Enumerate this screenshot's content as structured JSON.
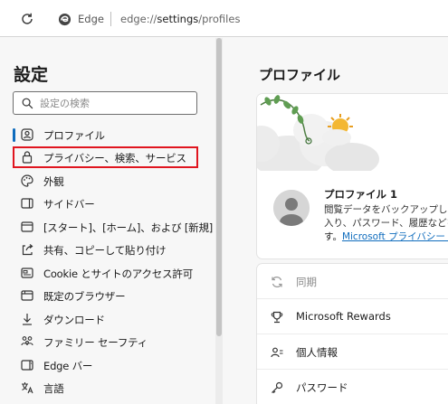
{
  "browser": {
    "name": "Edge",
    "url_prefix": "edge://",
    "url_host": "settings",
    "url_path": "/profiles"
  },
  "sidebar": {
    "title": "設定",
    "search_placeholder": "設定の検索",
    "items": [
      {
        "label": "プロファイル",
        "icon": "profile-icon",
        "active": true
      },
      {
        "label": "プライバシー、検索、サービス",
        "icon": "lock-icon",
        "highlighted": true
      },
      {
        "label": "外観",
        "icon": "palette-icon"
      },
      {
        "label": "サイドバー",
        "icon": "sidebar-icon"
      },
      {
        "label": "[スタート]、[ホーム]、および [新規] タブ",
        "icon": "home-tabs-icon"
      },
      {
        "label": "共有、コピーして貼り付け",
        "icon": "share-icon"
      },
      {
        "label": "Cookie とサイトのアクセス許可",
        "icon": "site-permissions-icon"
      },
      {
        "label": "既定のブラウザー",
        "icon": "default-browser-icon"
      },
      {
        "label": "ダウンロード",
        "icon": "download-icon"
      },
      {
        "label": "ファミリー セーフティ",
        "icon": "family-icon"
      },
      {
        "label": "Edge バー",
        "icon": "edge-bar-icon"
      },
      {
        "label": "言語",
        "icon": "language-icon"
      }
    ]
  },
  "main": {
    "title": "プロファイル",
    "profile": {
      "name": "プロファイル 1",
      "desc_line1": "閲覧データをバックアップし、すべ",
      "desc_line2": "入り、パスワード、履歴などを表",
      "desc_prefix": "す。",
      "privacy_link": "Microsoft プライバシー ステ"
    },
    "sections": [
      {
        "label": "同期",
        "icon": "sync-icon",
        "disabled": true
      },
      {
        "label": "Microsoft Rewards",
        "icon": "trophy-icon"
      },
      {
        "label": "個人情報",
        "icon": "person-card-icon"
      },
      {
        "label": "パスワード",
        "icon": "key-icon"
      }
    ]
  },
  "colors": {
    "accent": "#0f6cbd",
    "highlight_border": "#e0151f"
  }
}
